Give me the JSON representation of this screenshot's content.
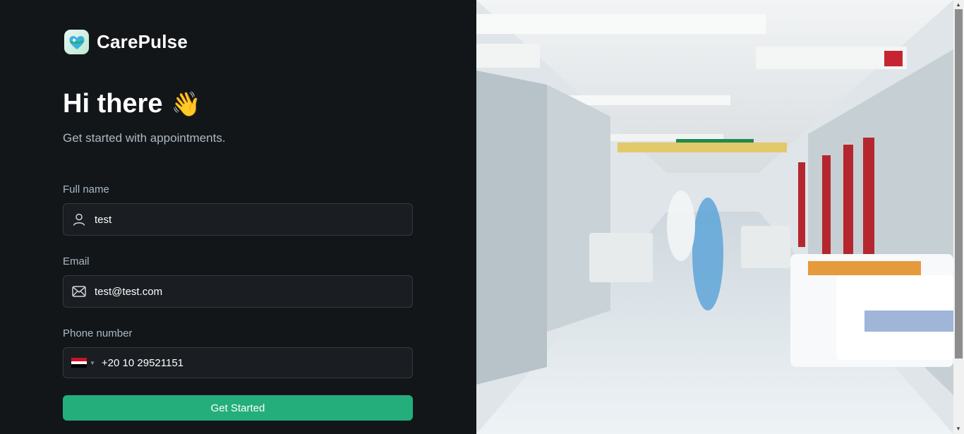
{
  "brand": {
    "name": "CarePulse"
  },
  "hero": {
    "greeting": "Hi there",
    "wave_emoji": "👋",
    "subtitle": "Get started with appointments."
  },
  "form": {
    "full_name": {
      "label": "Full name",
      "value": "test",
      "icon": "user-icon"
    },
    "email": {
      "label": "Email",
      "value": "test@test.com",
      "icon": "mail-icon"
    },
    "phone": {
      "label": "Phone number",
      "value": "+20 10 29521151",
      "country_flag": "egypt-flag-icon"
    },
    "submit_label": "Get Started"
  },
  "colors": {
    "accent": "#24ae7c",
    "background": "#131619",
    "field_bg": "#1a1d21",
    "field_border": "#363a3d",
    "muted_text": "#abb8c4"
  },
  "image": {
    "subject": "hospital-corridor"
  }
}
